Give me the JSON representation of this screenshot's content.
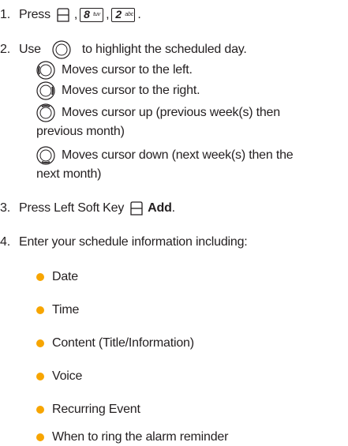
{
  "steps": {
    "s1": {
      "num": "1.",
      "text": "Press",
      "sep1": ",",
      "key1_digit": "8",
      "key1_letters": "tuv",
      "sep2": ",",
      "key2_digit": "2",
      "key2_letters": "abc",
      "end": "."
    },
    "s2": {
      "num": "2.",
      "text_before": "Use",
      "text_after": "to highlight the scheduled day."
    },
    "s3": {
      "num": "3.",
      "text": "Press Left Soft Key",
      "bold": "Add",
      "end": "."
    },
    "s4": {
      "num": "4.",
      "text": "Enter your schedule information including:"
    }
  },
  "moves": {
    "left": "Moves cursor to the left.",
    "right": "Moves cursor to the right.",
    "up_1": "Moves cursor up (previous week(s) then",
    "up_2": "previous month)",
    "down_1": "Moves cursor down (next week(s) then the",
    "down_2": "next month)"
  },
  "bullets": [
    "Date",
    "Time",
    "Content (Title/Information)",
    "Voice",
    "Recurring Event",
    "When to ring the alarm reminder"
  ],
  "colors": {
    "text": "#231f20",
    "bullet": "#f7a500"
  },
  "icons": {
    "soft_key": "left-soft-key-icon",
    "nav": "navigation-key-icon"
  }
}
